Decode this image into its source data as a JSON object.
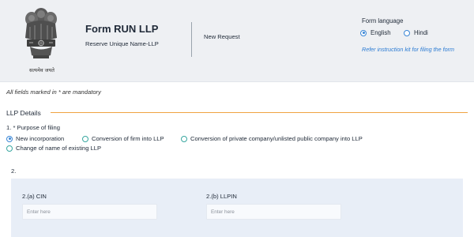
{
  "header": {
    "emblem_caption": "सत्यमेव जयते",
    "form_title": "Form RUN LLP",
    "form_subtitle": "Reserve Unique Name-LLP",
    "request_type": "New Request",
    "language": {
      "title": "Form language",
      "options": [
        {
          "label": "English",
          "selected": true
        },
        {
          "label": "Hindi",
          "selected": false
        }
      ],
      "instruction_link": "Refer instruction kit for filing the form"
    }
  },
  "form": {
    "mandatory_note": "All fields marked in * are mandatory",
    "section_title": "LLP Details",
    "purpose": {
      "label": "1. * Purpose of filing",
      "options": [
        {
          "label": "New incorporation",
          "selected": true
        },
        {
          "label": "Conversion of firm into LLP",
          "selected": false
        },
        {
          "label": "Conversion of private company/unlisted public company into LLP",
          "selected": false
        },
        {
          "label": "Change of name of existing LLP",
          "selected": false
        }
      ]
    },
    "q2_label": "2.",
    "cin": {
      "label": "2.(a) CIN",
      "placeholder": "Enter here",
      "value": ""
    },
    "llpin": {
      "label": "2.(b) LLPIN",
      "placeholder": "Enter here",
      "value": ""
    }
  },
  "colors": {
    "header_bg": "#eef0f3",
    "accent_orange": "#f0a341",
    "link_blue": "#2b7bd3",
    "radio_blue": "#3a86d6",
    "radio_teal": "#39a7a0",
    "panel_bg": "#e8eef7"
  }
}
